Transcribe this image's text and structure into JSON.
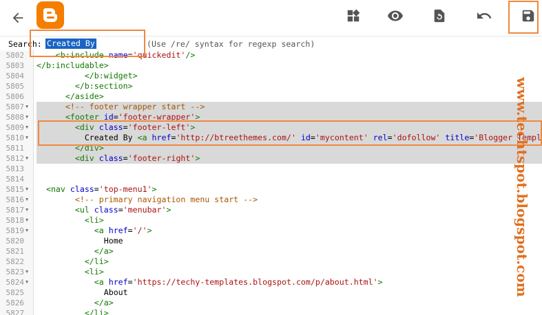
{
  "toolbar": {
    "icons": {
      "back": "arrow-left-icon",
      "logo": "blogger-logo",
      "widgets": "widgets-icon",
      "preview": "eye-icon",
      "revert": "revert-icon",
      "undo": "undo-icon",
      "save": "save-icon"
    }
  },
  "search": {
    "label": "Search:",
    "value": "Created By",
    "hint": "(Use /re/ syntax for regexp search)"
  },
  "colors": {
    "accent": "#f57d00",
    "annotation": "#f0883e",
    "selection": "#1a64c4",
    "tag": "#117700",
    "attribute": "#0000cc",
    "string": "#aa1111",
    "comment": "#aa5500"
  },
  "editor": {
    "lines": [
      {
        "n": "5802",
        "fold": false,
        "sel": false,
        "indent": "    ",
        "t": [
          [
            "tag",
            "<b:include"
          ],
          [
            "text",
            " "
          ],
          [
            "attr",
            "name"
          ],
          [
            "text",
            "="
          ],
          [
            "str",
            "'quickedit'"
          ],
          [
            "tag",
            "/>"
          ]
        ]
      },
      {
        "n": "5803",
        "fold": false,
        "sel": false,
        "indent": "",
        "t": [
          [
            "tag",
            "</b:includable>"
          ]
        ]
      },
      {
        "n": "5804",
        "fold": false,
        "sel": false,
        "indent": "          ",
        "t": [
          [
            "tag",
            "</b:widget>"
          ]
        ]
      },
      {
        "n": "5805",
        "fold": false,
        "sel": false,
        "indent": "        ",
        "t": [
          [
            "tag",
            "</b:section>"
          ]
        ]
      },
      {
        "n": "5806",
        "fold": false,
        "sel": false,
        "indent": "      ",
        "t": [
          [
            "tag",
            "</aside>"
          ]
        ]
      },
      {
        "n": "5807",
        "fold": true,
        "sel": true,
        "indent": "      ",
        "t": [
          [
            "comment",
            "<!-- footer wrapper start -->"
          ]
        ]
      },
      {
        "n": "5808",
        "fold": true,
        "sel": true,
        "indent": "      ",
        "t": [
          [
            "tag",
            "<footer"
          ],
          [
            "text",
            " "
          ],
          [
            "attr",
            "id"
          ],
          [
            "text",
            "="
          ],
          [
            "str",
            "'footer-wrapper'"
          ],
          [
            "tag",
            ">"
          ]
        ]
      },
      {
        "n": "5809",
        "fold": true,
        "sel": true,
        "indent": "        ",
        "t": [
          [
            "tag",
            "<div"
          ],
          [
            "text",
            " "
          ],
          [
            "attr",
            "class"
          ],
          [
            "text",
            "="
          ],
          [
            "str",
            "'footer-left'"
          ],
          [
            "tag",
            ">"
          ]
        ]
      },
      {
        "n": "5810",
        "fold": true,
        "sel": true,
        "indent": "          ",
        "t": [
          [
            "text",
            "Created By "
          ],
          [
            "tag",
            "<a"
          ],
          [
            "text",
            " "
          ],
          [
            "attr",
            "href"
          ],
          [
            "text",
            "="
          ],
          [
            "str",
            "'http://btreethemes.com/'"
          ],
          [
            "text",
            " "
          ],
          [
            "attr",
            "id"
          ],
          [
            "text",
            "="
          ],
          [
            "str",
            "'mycontent'"
          ],
          [
            "text",
            " "
          ],
          [
            "attr",
            "rel"
          ],
          [
            "text",
            "="
          ],
          [
            "str",
            "'dofollow'"
          ],
          [
            "text",
            " "
          ],
          [
            "attr",
            "title"
          ],
          [
            "text",
            "="
          ],
          [
            "str",
            "'Blogger Templates'"
          ],
          [
            "tag",
            ">"
          ]
        ]
      },
      {
        "n": "5811",
        "fold": false,
        "sel": true,
        "indent": "        ",
        "t": [
          [
            "tag",
            "</div>"
          ]
        ]
      },
      {
        "n": "5812",
        "fold": true,
        "sel": true,
        "indent": "        ",
        "t": [
          [
            "tag",
            "<div"
          ],
          [
            "text",
            " "
          ],
          [
            "attr",
            "class"
          ],
          [
            "text",
            "="
          ],
          [
            "str",
            "'footer-right'"
          ],
          [
            "tag",
            ">"
          ]
        ]
      },
      {
        "n": "5813",
        "fold": false,
        "sel": false,
        "indent": "",
        "t": []
      },
      {
        "n": "5814",
        "fold": false,
        "sel": false,
        "indent": "",
        "t": []
      },
      {
        "n": "5815",
        "fold": true,
        "sel": false,
        "indent": "  ",
        "t": [
          [
            "tag",
            "<nav"
          ],
          [
            "text",
            " "
          ],
          [
            "attr",
            "class"
          ],
          [
            "text",
            "="
          ],
          [
            "str",
            "'top-menu1'"
          ],
          [
            "tag",
            ">"
          ]
        ]
      },
      {
        "n": "5816",
        "fold": true,
        "sel": false,
        "indent": "        ",
        "t": [
          [
            "comment",
            "<!-- primary navigation menu start -->"
          ]
        ]
      },
      {
        "n": "5817",
        "fold": true,
        "sel": false,
        "indent": "        ",
        "t": [
          [
            "tag",
            "<ul"
          ],
          [
            "text",
            " "
          ],
          [
            "attr",
            "class"
          ],
          [
            "text",
            "="
          ],
          [
            "str",
            "'menubar'"
          ],
          [
            "tag",
            ">"
          ]
        ]
      },
      {
        "n": "5818",
        "fold": true,
        "sel": false,
        "indent": "          ",
        "t": [
          [
            "tag",
            "<li>"
          ]
        ]
      },
      {
        "n": "5819",
        "fold": true,
        "sel": false,
        "indent": "            ",
        "t": [
          [
            "tag",
            "<a"
          ],
          [
            "text",
            " "
          ],
          [
            "attr",
            "href"
          ],
          [
            "text",
            "="
          ],
          [
            "str",
            "'/'"
          ],
          [
            "tag",
            ">"
          ]
        ]
      },
      {
        "n": "5820",
        "fold": false,
        "sel": false,
        "indent": "              ",
        "t": [
          [
            "text",
            "Home"
          ]
        ]
      },
      {
        "n": "5821",
        "fold": false,
        "sel": false,
        "indent": "            ",
        "t": [
          [
            "tag",
            "</a>"
          ]
        ]
      },
      {
        "n": "5822",
        "fold": false,
        "sel": false,
        "indent": "          ",
        "t": [
          [
            "tag",
            "</li>"
          ]
        ]
      },
      {
        "n": "5823",
        "fold": true,
        "sel": false,
        "indent": "          ",
        "t": [
          [
            "tag",
            "<li>"
          ]
        ]
      },
      {
        "n": "5824",
        "fold": true,
        "sel": false,
        "indent": "            ",
        "t": [
          [
            "tag",
            "<a"
          ],
          [
            "text",
            " "
          ],
          [
            "attr",
            "href"
          ],
          [
            "text",
            "="
          ],
          [
            "str",
            "'https://techy-templates.blogspot.com/p/about.html'"
          ],
          [
            "tag",
            ">"
          ]
        ]
      },
      {
        "n": "5825",
        "fold": false,
        "sel": false,
        "indent": "              ",
        "t": [
          [
            "text",
            "About"
          ]
        ]
      },
      {
        "n": "5826",
        "fold": false,
        "sel": false,
        "indent": "            ",
        "t": [
          [
            "tag",
            "</a>"
          ]
        ]
      },
      {
        "n": "5827",
        "fold": false,
        "sel": false,
        "indent": "          ",
        "t": [
          [
            "tag",
            "</li>"
          ]
        ]
      }
    ]
  },
  "watermark": {
    "text": "www.techtspot.blogspot.com"
  }
}
